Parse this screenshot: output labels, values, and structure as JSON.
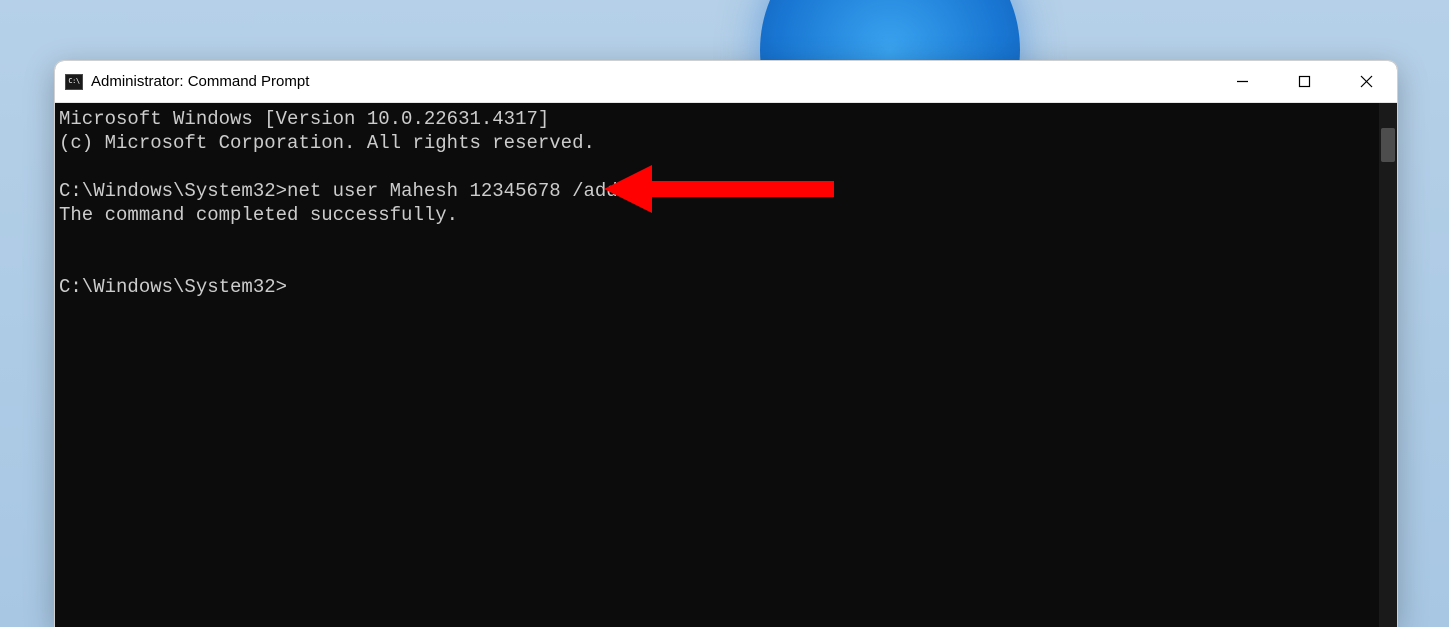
{
  "window": {
    "title": "Administrator: Command Prompt"
  },
  "terminal": {
    "line1": "Microsoft Windows [Version 10.0.22631.4317]",
    "line2": "(c) Microsoft Corporation. All rights reserved.",
    "blank1": "",
    "prompt1_path": "C:\\Windows\\System32>",
    "prompt1_cmd": "net user Mahesh 12345678 /add",
    "result": "The command completed successfully.",
    "blank2": "",
    "blank3": "",
    "prompt2_path": "C:\\Windows\\System32>",
    "prompt2_cmd": ""
  },
  "annotation": {
    "arrow_color": "#ff0101"
  }
}
